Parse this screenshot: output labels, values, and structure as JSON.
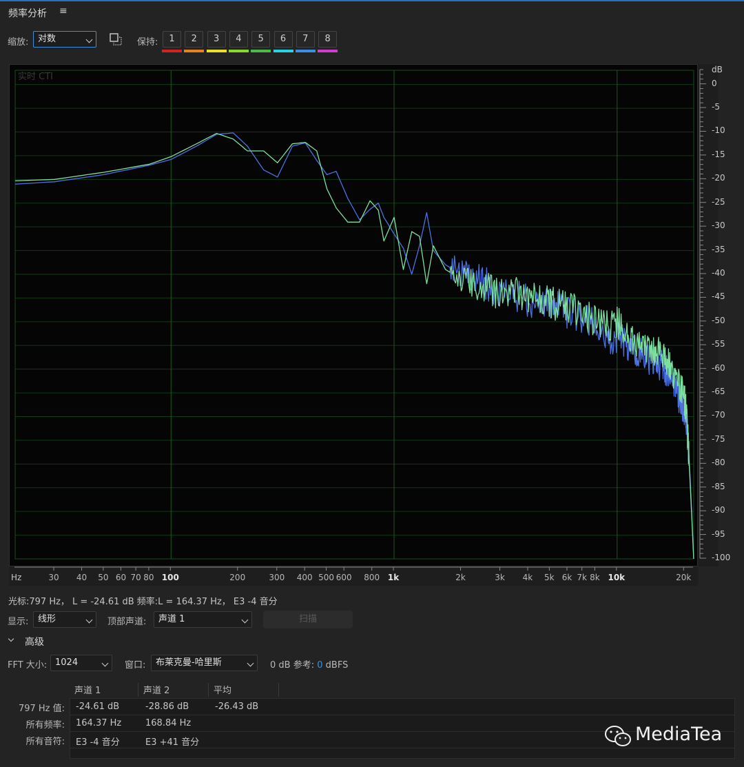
{
  "panel": {
    "title": "频率分析",
    "menu_icon": "≡"
  },
  "toolbar": {
    "zoom_label": "缩放:",
    "zoom_value": "对数",
    "hold_label": "保持:",
    "hold_buttons": [
      {
        "label": "1",
        "color": "#d32222"
      },
      {
        "label": "2",
        "color": "#e8821c"
      },
      {
        "label": "3",
        "color": "#e8e02a"
      },
      {
        "label": "4",
        "color": "#8ad82a"
      },
      {
        "label": "5",
        "color": "#4cbb4c"
      },
      {
        "label": "6",
        "color": "#28d2e6"
      },
      {
        "label": "7",
        "color": "#3a8ee6"
      },
      {
        "label": "8",
        "color": "#d23cd2"
      }
    ]
  },
  "graph": {
    "overlay_label": "实时 CTI",
    "db_unit": "dB",
    "db_ticks": [
      "0",
      "-5",
      "-10",
      "-15",
      "-20",
      "-25",
      "-30",
      "-35",
      "-40",
      "-45",
      "-50",
      "-55",
      "-60",
      "-65",
      "-70",
      "-75",
      "-80",
      "-85",
      "-90",
      "-95",
      "-100"
    ],
    "hz_unit": "Hz",
    "hz_ticks": [
      {
        "f": 30,
        "label": "30",
        "major": false
      },
      {
        "f": 40,
        "label": "40",
        "major": false
      },
      {
        "f": 50,
        "label": "50",
        "major": false
      },
      {
        "f": 60,
        "label": "60",
        "major": false
      },
      {
        "f": 70,
        "label": "70",
        "major": false
      },
      {
        "f": 80,
        "label": "80",
        "major": false
      },
      {
        "f": 100,
        "label": "100",
        "major": true
      },
      {
        "f": 200,
        "label": "200",
        "major": false
      },
      {
        "f": 300,
        "label": "300",
        "major": false
      },
      {
        "f": 400,
        "label": "400",
        "major": false
      },
      {
        "f": 500,
        "label": "500",
        "major": false
      },
      {
        "f": 600,
        "label": "600",
        "major": false
      },
      {
        "f": 800,
        "label": "800",
        "major": false
      },
      {
        "f": 1000,
        "label": "1k",
        "major": true
      },
      {
        "f": 2000,
        "label": "2k",
        "major": false
      },
      {
        "f": 3000,
        "label": "3k",
        "major": false
      },
      {
        "f": 4000,
        "label": "4k",
        "major": false
      },
      {
        "f": 5000,
        "label": "5k",
        "major": false
      },
      {
        "f": 6000,
        "label": "6k",
        "major": false
      },
      {
        "f": 7000,
        "label": "7k",
        "major": false
      },
      {
        "f": 8000,
        "label": "8k",
        "major": false
      },
      {
        "f": 10000,
        "label": "10k",
        "major": true
      },
      {
        "f": 20000,
        "label": "20k",
        "major": false
      }
    ],
    "grid_color": "#0f3a14",
    "grid_major_color": "#1c5a22"
  },
  "chart_data": {
    "type": "line",
    "x_scale": "log",
    "xlim": [
      20,
      22050
    ],
    "ylim": [
      -100,
      3
    ],
    "xlabel": "Hz",
    "ylabel": "dB",
    "series": [
      {
        "color": "#4d72e0",
        "x": [
          20,
          30,
          50,
          80,
          100,
          130,
          160,
          190,
          220,
          260,
          300,
          350,
          400,
          450,
          500,
          550,
          620,
          700,
          780,
          850,
          900,
          1000,
          1100,
          1200,
          1300,
          1400,
          1500,
          1700,
          2000,
          2300,
          2600,
          3000,
          3500,
          4000,
          4500,
          5000,
          5500,
          6000,
          7000,
          8000,
          9000,
          10000,
          11000,
          12000,
          13000,
          14000,
          15000,
          16000,
          17000,
          18000,
          19000,
          20000,
          20500,
          21000,
          21500,
          22050
        ],
        "y": [
          -21,
          -20.5,
          -19,
          -17,
          -15.8,
          -13,
          -10.5,
          -10.2,
          -13,
          -18,
          -19.5,
          -13,
          -12.3,
          -16,
          -19,
          -18.3,
          -24,
          -28.5,
          -26.3,
          -25,
          -28,
          -31.5,
          -34.5,
          -40,
          -34,
          -27,
          -35,
          -38,
          -40,
          -41,
          -42,
          -44,
          -44.5,
          -45.5,
          -46,
          -46.5,
          -47,
          -48,
          -49,
          -51,
          -54,
          -53,
          -55,
          -56,
          -57,
          -58,
          -59,
          -59,
          -61,
          -63,
          -66,
          -69,
          -72,
          -78,
          -88,
          -100
        ]
      },
      {
        "color": "#7ee0a0",
        "x": [
          20,
          30,
          50,
          80,
          100,
          130,
          160,
          190,
          220,
          260,
          300,
          350,
          400,
          450,
          500,
          550,
          620,
          700,
          780,
          850,
          900,
          1000,
          1100,
          1200,
          1300,
          1400,
          1500,
          1700,
          2000,
          2300,
          2600,
          3000,
          3500,
          4000,
          4500,
          5000,
          5500,
          6000,
          7000,
          8000,
          9000,
          10000,
          11000,
          12000,
          13000,
          14000,
          15000,
          16000,
          17000,
          18000,
          19000,
          20000,
          20500,
          21000,
          21500,
          22050
        ],
        "y": [
          -20.3,
          -20,
          -18.5,
          -16.8,
          -15.2,
          -12.5,
          -10.3,
          -11.5,
          -14,
          -14,
          -16.5,
          -12.5,
          -12.2,
          -14,
          -22,
          -26,
          -29,
          -29,
          -24.5,
          -26.5,
          -33,
          -28,
          -39,
          -31,
          -32,
          -42,
          -34,
          -39,
          -41,
          -43,
          -43,
          -44,
          -44,
          -45,
          -45.5,
          -46,
          -46.5,
          -47,
          -48,
          -50,
          -51,
          -50,
          -53,
          -54,
          -54,
          -56,
          -56.5,
          -57,
          -59,
          -61,
          -63,
          -66,
          -70,
          -79,
          -89,
          -100
        ]
      }
    ]
  },
  "status_line": "光标:797 Hz， L = -24.61 dB   频率:L = 164.37 Hz， E3 -4 音分",
  "controls": {
    "display_label": "显示:",
    "display_value": "线形",
    "top_channel_label": "顶部声道:",
    "top_channel_value": "声道 1",
    "scan_label": "扫描"
  },
  "advanced": {
    "title": "高级",
    "fft_label": "FFT 大小:",
    "fft_value": "1024",
    "window_label": "窗口:",
    "window_value": "布莱克曼-哈里斯",
    "ref_label": "0 dB 参考:",
    "ref_value": "0",
    "ref_unit": "dBFS"
  },
  "table": {
    "headers": [
      "声道 1",
      "声道 2",
      "平均"
    ],
    "rows": [
      {
        "label": "797 Hz 值:",
        "cells": [
          "-24.61 dB",
          "-28.86 dB",
          "-26.43 dB"
        ]
      },
      {
        "label": "所有频率:",
        "cells": [
          "164.37 Hz",
          "168.84 Hz",
          ""
        ]
      },
      {
        "label": "所有音符:",
        "cells": [
          "E3 -4 音分",
          "E3 +41 音分",
          ""
        ]
      }
    ]
  },
  "watermark": "MediaTea"
}
